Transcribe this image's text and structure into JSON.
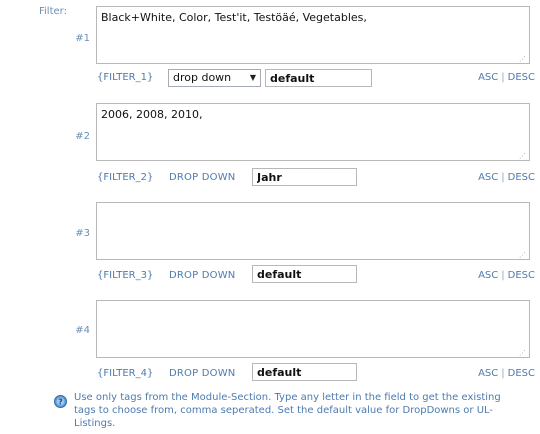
{
  "header": {
    "filter_label": "Filter:"
  },
  "rows": [
    {
      "number": "#1",
      "tags_value": "Black+White, Color, Test'it, Testöäé, Vegetables,",
      "key": "{FILTER_1}",
      "type_select_value": "drop down",
      "default_value": "default",
      "asc_label": "ASC",
      "separator": "|",
      "desc_label": "DESC"
    },
    {
      "number": "#2",
      "tags_value": "2006, 2008, 2010,",
      "key": "{FILTER_2}",
      "type_label": "DROP DOWN",
      "default_value": "Jahr",
      "asc_label": "ASC",
      "separator": "|",
      "desc_label": "DESC"
    },
    {
      "number": "#3",
      "tags_value": "",
      "key": "{FILTER_3}",
      "type_label": "DROP DOWN",
      "default_value": "default",
      "asc_label": "ASC",
      "separator": "|",
      "desc_label": "DESC"
    },
    {
      "number": "#4",
      "tags_value": "",
      "key": "{FILTER_4}",
      "type_label": "DROP DOWN",
      "default_value": "default",
      "asc_label": "ASC",
      "separator": "|",
      "desc_label": "DESC"
    }
  ],
  "help": {
    "icon": "info-icon",
    "text": "Use only tags from the Module-Section. Type any letter in the field to get the existing tags to choose from, comma seperated. Set the default value for DropDowns or UL-Listings."
  },
  "colors": {
    "label": "#6b8fb5",
    "link": "#4d7bb0",
    "border": "#b8b8b8",
    "icon_fill": "#5b9bd5"
  }
}
